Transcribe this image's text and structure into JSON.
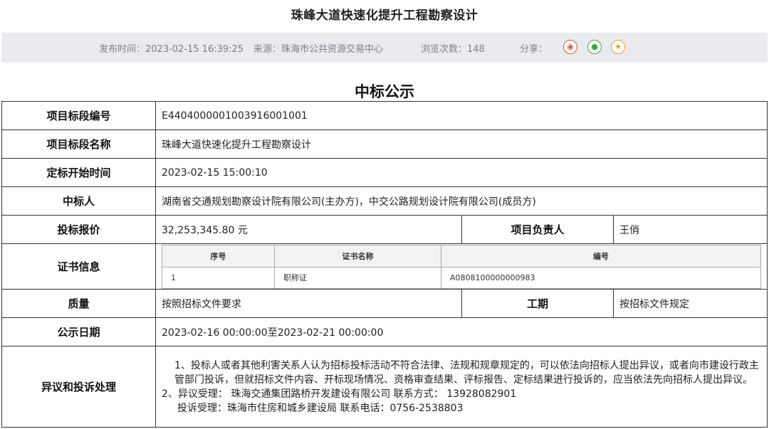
{
  "page": {
    "title": "珠峰大道快速化提升工程勘察设计"
  },
  "meta": {
    "publish_time": "发布时间：2023-02-15 16:39:25",
    "source": "来源：珠海市公共资源交易中心",
    "views": "浏览次数：148",
    "share_label": "分享：",
    "share_icons": [
      "weibo-icon",
      "wechat-icon",
      "favorite-icon"
    ],
    "colors": {
      "weibo": "#e2552a",
      "wechat": "#3ca93c",
      "favorite": "#e9a21a"
    }
  },
  "notice": {
    "title": "中标公示",
    "rows": {
      "section_code_label": "项目标段编号",
      "section_code": "E4404000001003916001001",
      "section_name_label": "项目标段名称",
      "section_name": "珠峰大道快速化提升工程勘察设计",
      "start_time_label": "定标开始时间",
      "start_time": "2023-02-15 15:00:10",
      "winner_label": "中标人",
      "winner": "湖南省交通规划勘察设计院有限公司(主办方)，中交公路规划设计院有限公司(成员方)",
      "bid_price_label": "投标报价",
      "bid_price": "32,253,345.80 元",
      "pm_label": "项目负责人",
      "pm": "王俏",
      "cert_label": "证书信息",
      "quality_label": "质量",
      "quality": "按照招标文件要求",
      "duration_label": "工期",
      "duration": "按招标文件规定",
      "notice_date_label": "公示日期",
      "notice_date": "2023-02-16 00:00:00至2023-02-21 00:00:00",
      "objection_label": "异议和投诉处理"
    },
    "cert_table": {
      "headers": [
        "序号",
        "证书名称",
        "编号"
      ],
      "rows": [
        [
          "1",
          "职称证",
          "A0808100000000983"
        ]
      ]
    },
    "objection": {
      "line1": "1、投标人或者其他利害关系人认为招标投标活动不符合法律、法规和规章规定的，可以依法向招标人提出异议，或者向市建设行政主管部门投诉，但就招标文件内容、开标现场情况、资格审查结果、评标报告、定标结果进行投诉的，应当依法先向招标人提出异议。",
      "line2": "2、异议受理：  珠海交通集团路桥开发建设有限公司    联系方式：  13928082901",
      "line3": "投诉受理：珠海市住房和城乡建设局 联系电话：0756-2538803"
    }
  }
}
